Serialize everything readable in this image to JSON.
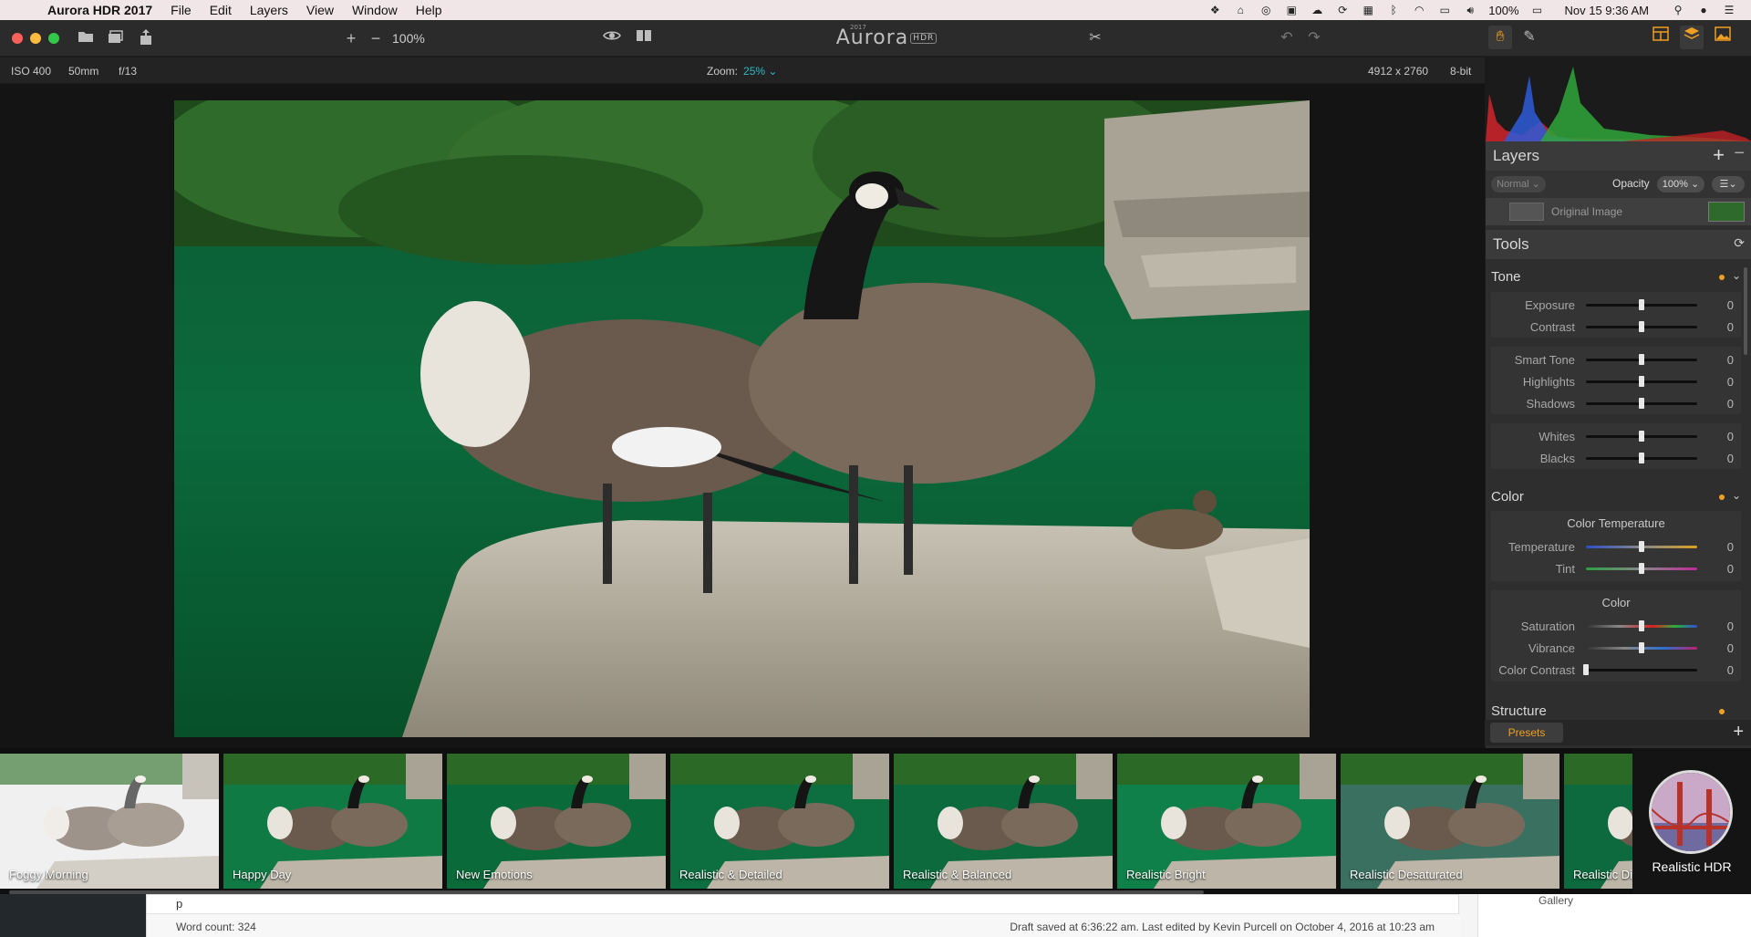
{
  "menubar": {
    "app_name": "Aurora HDR 2017",
    "items": [
      "File",
      "Edit",
      "Layers",
      "View",
      "Window",
      "Help"
    ],
    "battery": "100%",
    "datetime": "Nov 15  9:36 AM"
  },
  "toolbar": {
    "zoom_value": "100%",
    "logo_text": "Aurora",
    "logo_year": "2017",
    "logo_badge": "HDR"
  },
  "infobar": {
    "iso": "ISO 400",
    "focal": "50mm",
    "aperture": "f/13",
    "zoom_label": "Zoom:",
    "zoom_value": "25% ⌄",
    "dimensions": "4912 x 2760",
    "bit_depth": "8-bit"
  },
  "layers": {
    "title": "Layers",
    "blend_mode": "Normal ⌄",
    "opacity_label": "Opacity",
    "opacity_value": "100% ⌄",
    "layer_name": "Original Image"
  },
  "tools": {
    "title": "Tools",
    "tone": {
      "title": "Tone",
      "sliders": [
        {
          "label": "Exposure",
          "value": "0",
          "pos": 0.5
        },
        {
          "label": "Contrast",
          "value": "0",
          "pos": 0.5
        },
        {
          "label": "Smart Tone",
          "value": "0",
          "pos": 0.5
        },
        {
          "label": "Highlights",
          "value": "0",
          "pos": 0.5
        },
        {
          "label": "Shadows",
          "value": "0",
          "pos": 0.5
        },
        {
          "label": "Whites",
          "value": "0",
          "pos": 0.5
        },
        {
          "label": "Blacks",
          "value": "0",
          "pos": 0.5
        }
      ]
    },
    "color": {
      "title": "Color",
      "temp_title": "Color Temperature",
      "color_title": "Color",
      "sliders": [
        {
          "label": "Temperature",
          "value": "0",
          "pos": 0.5
        },
        {
          "label": "Tint",
          "value": "0",
          "pos": 0.5
        },
        {
          "label": "Saturation",
          "value": "0",
          "pos": 0.5
        },
        {
          "label": "Vibrance",
          "value": "0",
          "pos": 0.5
        },
        {
          "label": "Color Contrast",
          "value": "0",
          "pos": 0.0
        }
      ]
    },
    "structure_title": "Structure"
  },
  "presets": {
    "tab_label": "Presets",
    "items": [
      "Foggy Morning",
      "Happy Day",
      "New Emotions",
      "Realistic & Detailed",
      "Realistic & Balanced",
      "Realistic Bright",
      "Realistic Desaturated",
      "Realistic Di"
    ],
    "category": "Realistic HDR"
  },
  "underlying": {
    "ptag": "p",
    "word_count": "Word count: 324",
    "draft": "Draft saved at 6:36:22 am. Last edited by Kevin Purcell on October 4, 2016 at 10:23 am",
    "side_text": "Gallery"
  },
  "colors": {
    "accent_orange": "#f0a020",
    "accent_cyan": "#2cb8c8",
    "panel_bg": "#2e2e2e"
  }
}
